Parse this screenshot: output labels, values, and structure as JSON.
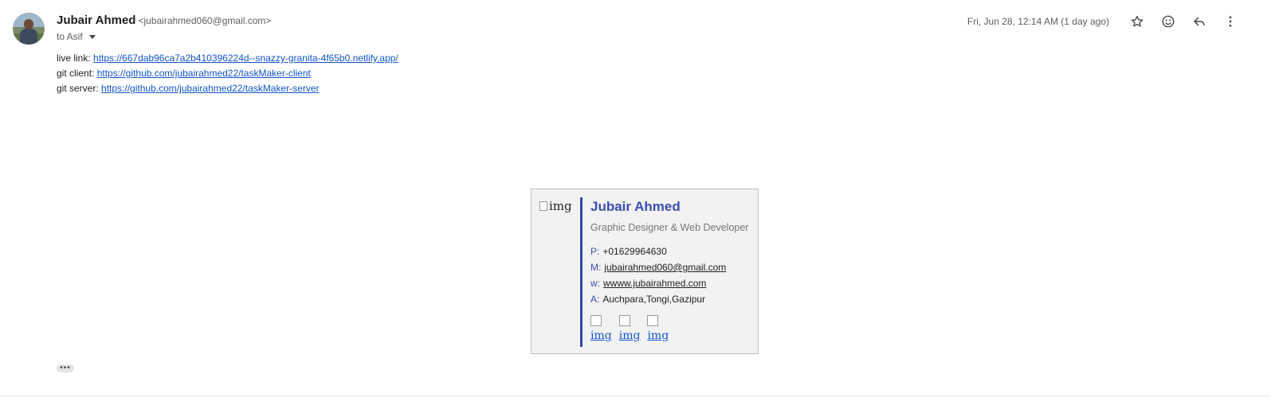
{
  "sender": {
    "name": "Jubair Ahmed",
    "email": "<jubairahmed060@gmail.com>"
  },
  "recipient": {
    "label": "to Asif"
  },
  "date": "Fri, Jun 28, 12:14 AM (1 day ago)",
  "actions": {
    "icons": [
      "star-icon",
      "emoji-icon",
      "reply-icon",
      "more-vert-icon"
    ]
  },
  "body": {
    "lines": [
      {
        "label": "live link:",
        "url": "https://667dab96ca7a2b410396224d--snazzy-granita-4f65b0.netlify.app/"
      },
      {
        "label": "git client:",
        "url": "https://github.com/jubairahmed22/taskMaker-client"
      },
      {
        "label": "git server:",
        "url": "https://github.com/jubairahmed22/taskMaker-server"
      }
    ]
  },
  "signature": {
    "img_alt": "img",
    "name": "Jubair Ahmed",
    "title": "Graphic Designer & Web Developer",
    "phone_key": "P:",
    "phone": "+01629964630",
    "mail_key": "M:",
    "mail": "jubairahmed060@gmail.com",
    "web_key": "w:",
    "web": "wwww.jubairahmed.com",
    "address_key": "A:",
    "address": "Auchpara,Tongi,Gazipur",
    "socials": [
      "img",
      "img",
      "img"
    ]
  },
  "more_label": "•••",
  "colors": {
    "accent": "#2e49a8",
    "link": "#1155cc"
  }
}
